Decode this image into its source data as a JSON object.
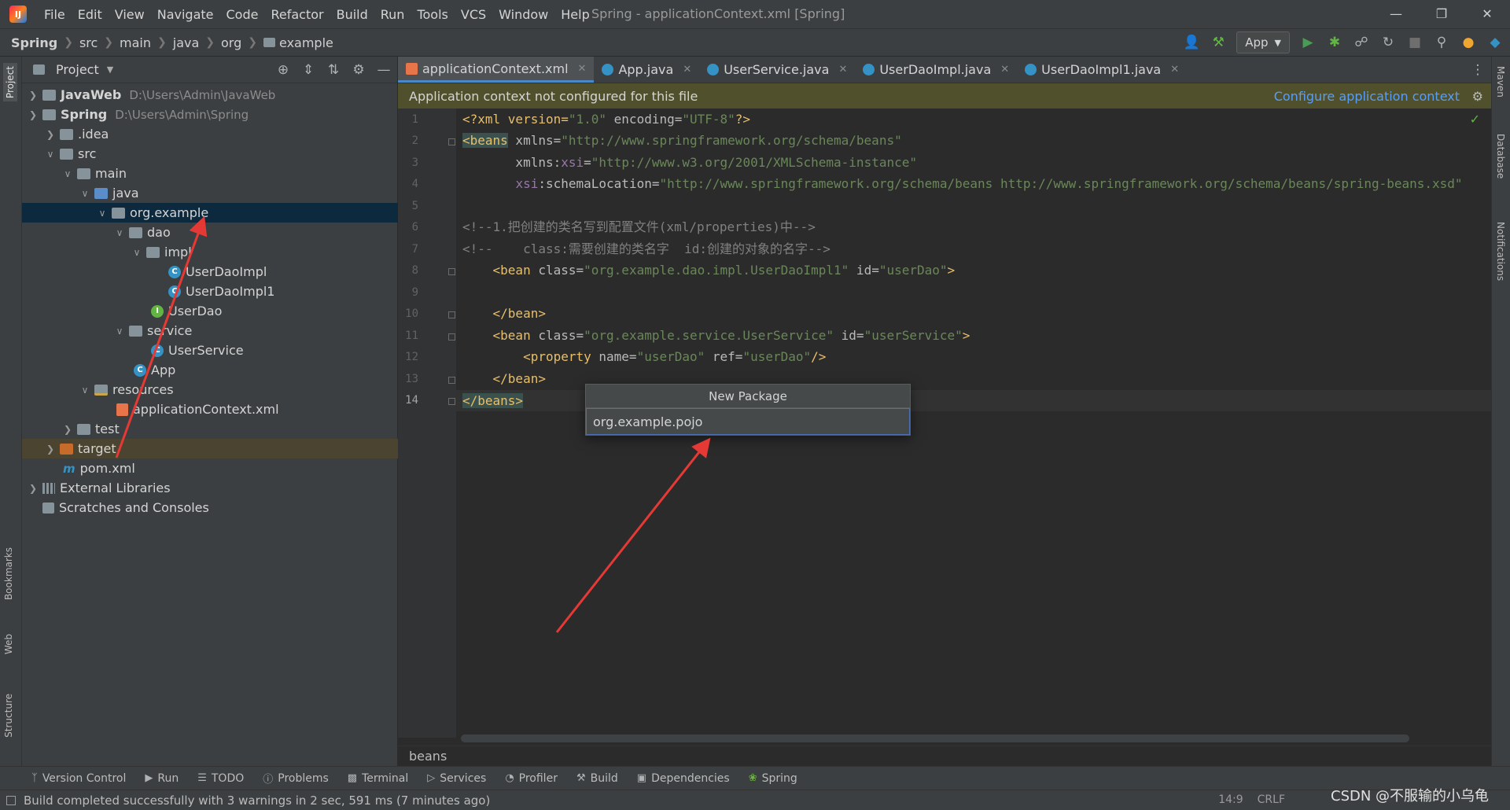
{
  "window": {
    "title": "Spring - applicationContext.xml [Spring]",
    "menu": [
      "File",
      "Edit",
      "View",
      "Navigate",
      "Code",
      "Refactor",
      "Build",
      "Run",
      "Tools",
      "VCS",
      "Window",
      "Help"
    ]
  },
  "breadcrumb": [
    "Spring",
    "src",
    "main",
    "java",
    "org",
    "example"
  ],
  "toolbar": {
    "run_config": "App"
  },
  "left_tools": [
    "Project",
    "Bookmarks",
    "Web",
    "Structure"
  ],
  "right_tools": [
    "Maven",
    "Database",
    "Notifications"
  ],
  "project_panel": {
    "title": "Project",
    "tree": [
      {
        "label": "JavaWeb",
        "path": "D:\\Users\\Admin\\JavaWeb"
      },
      {
        "label": "Spring",
        "path": "D:\\Users\\Admin\\Spring"
      },
      {
        "label": ".idea"
      },
      {
        "label": "src"
      },
      {
        "label": "main"
      },
      {
        "label": "java"
      },
      {
        "label": "org.example"
      },
      {
        "label": "dao"
      },
      {
        "label": "impl"
      },
      {
        "label": "UserDaoImpl"
      },
      {
        "label": "UserDaoImpl1"
      },
      {
        "label": "UserDao"
      },
      {
        "label": "service"
      },
      {
        "label": "UserService"
      },
      {
        "label": "App"
      },
      {
        "label": "resources"
      },
      {
        "label": "applicationContext.xml"
      },
      {
        "label": "test"
      },
      {
        "label": "target"
      },
      {
        "label": "pom.xml"
      },
      {
        "label": "External Libraries"
      },
      {
        "label": "Scratches and Consoles"
      }
    ]
  },
  "editor": {
    "tabs": [
      "applicationContext.xml",
      "App.java",
      "UserService.java",
      "UserDaoImpl.java",
      "UserDaoImpl1.java"
    ],
    "banner": {
      "message": "Application context not configured for this file",
      "link": "Configure application context"
    },
    "line_numbers": [
      "1",
      "2",
      "3",
      "4",
      "5",
      "6",
      "7",
      "8",
      "9",
      "10",
      "11",
      "12",
      "13",
      "14"
    ],
    "code": {
      "l1a": "<?xml version=",
      "l1b": "\"1.0\"",
      "l1c": " encoding=",
      "l1d": "\"UTF-8\"",
      "l1e": "?>",
      "l2a": "<beans",
      "l2b": " xmlns=",
      "l2c": "\"http://www.springframework.org/schema/beans\"",
      "l3a": "       xmlns:",
      "l3b": "xsi",
      "l3c": "=",
      "l3d": "\"http://www.w3.org/2001/XMLSchema-instance\"",
      "l4a": "       ",
      "l4b": "xsi",
      "l4c": ":schemaLocation=",
      "l4d": "\"http://www.springframework.org/schema/beans http://www.springframework.org/schema/beans/spring-beans.xsd\"",
      "l6": "<!--1.把创建的类名写到配置文件(xml/properties)中-->",
      "l7": "<!--    class:需要创建的类名字  id:创建的对象的名字-->",
      "l8a": "    <bean",
      "l8b": " class=",
      "l8c": "\"org.example.dao.impl.UserDaoImpl1\"",
      "l8d": " id=",
      "l8e": "\"userDao\"",
      "l8f": ">",
      "l10": "    </bean>",
      "l11a": "    <bean",
      "l11b": " class=",
      "l11c": "\"org.example.service.UserService\"",
      "l11d": " id=",
      "l11e": "\"userService\"",
      "l11f": ">",
      "l12a": "        <property",
      "l12b": " name=",
      "l12c": "\"userDao\"",
      "l12d": " ref=",
      "l12e": "\"userDao\"",
      "l12f": "/>",
      "l13": "    </bean>",
      "l14": "</beans>"
    },
    "breadcrumb": "beans"
  },
  "popup": {
    "title": "New Package",
    "value": "org.example.pojo"
  },
  "bottom_tools": [
    "Version Control",
    "Run",
    "TODO",
    "Problems",
    "Terminal",
    "Services",
    "Profiler",
    "Build",
    "Dependencies",
    "Spring"
  ],
  "status": {
    "message": "Build completed successfully with 3 warnings in 2 sec, 591 ms (7 minutes ago)",
    "position": "14:9",
    "line_sep": "CRLF"
  },
  "watermark": "CSDN @不服输的小乌龟",
  "colors": {
    "annotation_arrow": "#e53935",
    "accent": "#4a88c7",
    "banner": "#50502d"
  }
}
